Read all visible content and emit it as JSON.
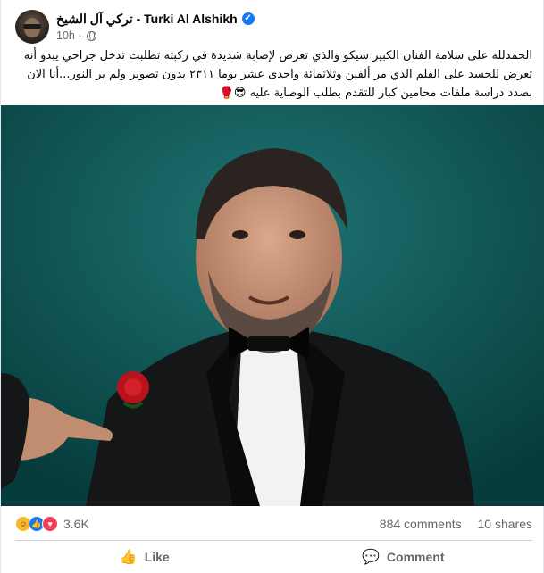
{
  "post": {
    "author_arabic": "تركي آل الشيخ",
    "author_separator": " - ",
    "author_latin": "Turki Al Alshikh",
    "verified_icon": "verified-badge-icon",
    "time": "10h",
    "privacy_icon": "globe-icon",
    "text": "الحمدلله على سلامة الفنان الكبير شيكو والذي تعرض لإصابة شديدة في ركبته تطلبت تدخل جراحي  يبدو أنه تعرض للحسد على الفلم الذي مر ألفين وثلاثمائة واحدى عشر يوما ٢٣١١ بدون تصوير ولم ير النور...أنا الان بصدد دراسة ملفات محامين كبار للتقدم بطلب الوصاية عليه 😎🥊",
    "image_icon": "photo-image"
  },
  "stats": {
    "reaction_icons": [
      "haha-icon",
      "like-icon",
      "love-icon"
    ],
    "reaction_count": "3.6K",
    "comments": "884 comments",
    "shares": "10 shares"
  },
  "actions": {
    "like_label": "Like",
    "comment_label": "Comment"
  },
  "colors": {
    "accent": "#1877f2",
    "muted": "#65676b",
    "photo_bg": "#0c5656"
  }
}
